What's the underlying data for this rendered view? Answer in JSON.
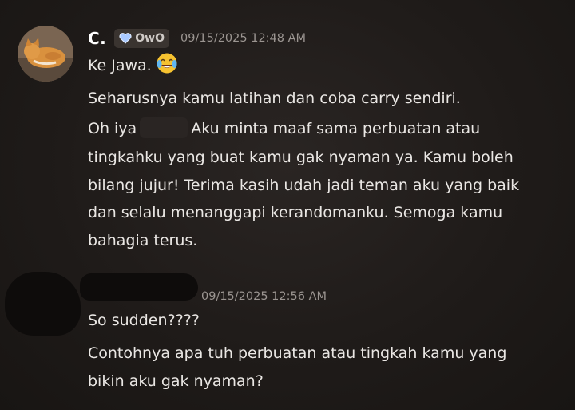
{
  "messages": [
    {
      "username": "C.",
      "tag": "OwO",
      "timestamp": "09/15/2025 12:48 AM",
      "lines": [
        "Ke Jawa.",
        "Seharusnya kamu latihan dan coba carry sendiri.",
        "Oh iya",
        "Aku minta maaf sama perbuatan atau",
        "tingkahku yang buat kamu gak nyaman ya. Kamu boleh",
        "bilang jujur! Terima kasih udah jadi teman aku yang baik",
        "dan selalu menanggapi kerandomanku. Semoga kamu",
        "bahagia terus."
      ]
    },
    {
      "timestamp": "09/15/2025 12:56 AM",
      "lines": [
        "So sudden????",
        "Contohnya apa tuh perbuatan atau tingkah kamu yang",
        "bikin aku gak nyaman?"
      ]
    }
  ],
  "icons": {
    "emoji": "face-with-tears-of-joy-icon",
    "tag_icon": "heart-icon",
    "accent": "#a9c9ff"
  }
}
